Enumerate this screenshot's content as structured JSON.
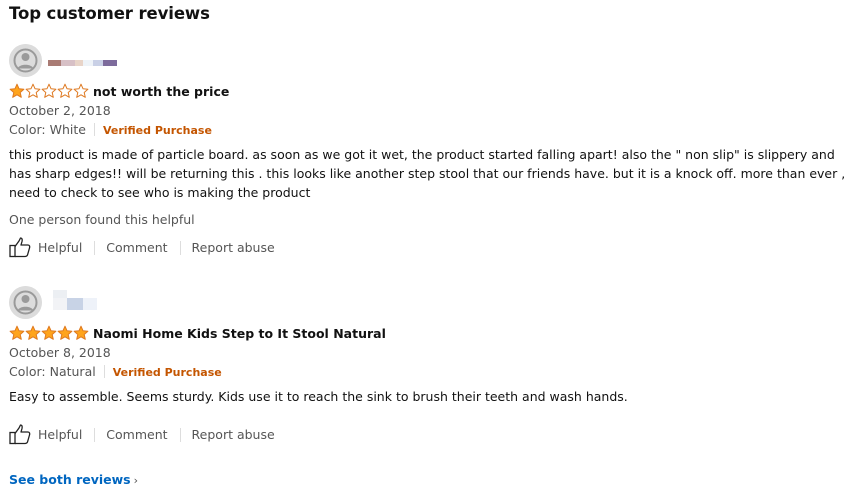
{
  "section": {
    "title": "Top customer reviews"
  },
  "reviews": [
    {
      "rating": 1,
      "title": "not worth the price",
      "date": "October 2, 2018",
      "variant": "Color: White",
      "verified": "Verified Purchase",
      "body": "this product is made of particle board. as soon as we got it wet, the product started falling apart! also the \" non slip\" is slippery and has sharp edges!! will be returning this . this looks like another step stool that our friends have. but it is a knock off. more than ever , need to check to see who is making the product",
      "helpful_count": "One person found this helpful",
      "actions": {
        "helpful": "Helpful",
        "comment": "Comment",
        "report": "Report abuse"
      }
    },
    {
      "rating": 5,
      "title": "Naomi Home Kids Step to It Stool Natural",
      "date": "October 8, 2018",
      "variant": "Color: Natural",
      "verified": "Verified Purchase",
      "body": "Easy to assemble. Seems sturdy. Kids use it to reach the sink to brush their teeth and wash hands.",
      "helpful_count": "",
      "actions": {
        "helpful": "Helpful",
        "comment": "Comment",
        "report": "Report abuse"
      }
    }
  ],
  "footer": {
    "see_all": "See both reviews",
    "chevron": "›"
  },
  "colors": {
    "star": "#ffa41c",
    "star_stroke": "#de7921",
    "verified": "#c45500",
    "link": "#0066c0"
  },
  "icons": {
    "avatar": "avatar-icon",
    "thumb": "thumbs-up-icon",
    "star_full": "star-filled-icon",
    "star_empty": "star-empty-icon"
  }
}
